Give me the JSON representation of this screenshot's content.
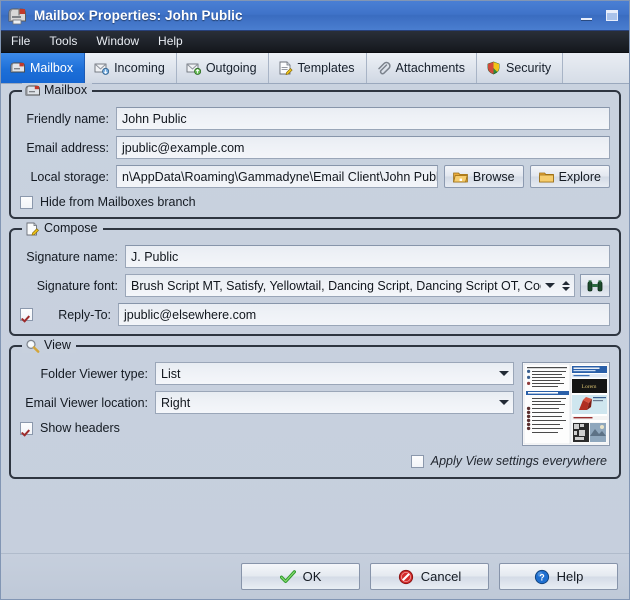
{
  "window": {
    "title": "Mailbox Properties: John Public",
    "app_icon": "mailbox-icon",
    "minimize_label": "Minimize",
    "maximize_label": "Maximize"
  },
  "menubar": {
    "items": [
      {
        "label": "File"
      },
      {
        "label": "Tools"
      },
      {
        "label": "Window"
      },
      {
        "label": "Help"
      }
    ]
  },
  "tabs": [
    {
      "label": "Mailbox",
      "icon": "mailbox-icon",
      "active": true
    },
    {
      "label": "Incoming",
      "icon": "inbox-icon",
      "active": false
    },
    {
      "label": "Outgoing",
      "icon": "outbox-icon",
      "active": false
    },
    {
      "label": "Templates",
      "icon": "template-icon",
      "active": false
    },
    {
      "label": "Attachments",
      "icon": "paperclip-icon",
      "active": false
    },
    {
      "label": "Security",
      "icon": "shield-icon",
      "active": false
    }
  ],
  "mailbox_group": {
    "title": "Mailbox",
    "icon": "mailbox-icon",
    "friendly_name_label": "Friendly name:",
    "friendly_name_value": "John Public",
    "email_address_label": "Email address:",
    "email_address_value": "jpublic@example.com",
    "local_storage_label": "Local storage:",
    "local_storage_value": "n\\AppData\\Roaming\\Gammadyne\\Email Client\\John Public",
    "browse_label": "Browse",
    "explore_label": "Explore",
    "hide_checkbox_label": "Hide from Mailboxes branch",
    "hide_checkbox_checked": false
  },
  "compose_group": {
    "title": "Compose",
    "icon": "compose-icon",
    "signature_name_label": "Signature name:",
    "signature_name_value": "J. Public",
    "signature_font_label": "Signature font:",
    "signature_font_value": "Brush Script MT, Satisfy, Yellowtail, Dancing Script, Dancing Script OT, Coc",
    "font_find_icon": "binoculars-icon",
    "reply_to_label": "Reply-To:",
    "reply_to_value": "jpublic@elsewhere.com",
    "reply_to_checked": true
  },
  "view_group": {
    "title": "View",
    "icon": "magnifier-icon",
    "folder_viewer_label": "Folder Viewer type:",
    "folder_viewer_value": "List",
    "email_viewer_label": "Email Viewer location:",
    "email_viewer_value": "Right",
    "show_headers_label": "Show headers",
    "show_headers_checked": true,
    "apply_everywhere_label": "Apply View settings everywhere",
    "apply_everywhere_checked": false,
    "preview_alt": "layout-preview-thumbnail"
  },
  "footer": {
    "ok_label": "OK",
    "cancel_label": "Cancel",
    "help_label": "Help"
  },
  "colors": {
    "titlebar_blue": "#3f73c9",
    "active_tab_blue": "#1d6fd8",
    "window_bg": "#c8d1de",
    "menubar_dark": "#1d2128",
    "check_red": "#9d2b2b",
    "ok_green": "#2f9b2f",
    "cancel_red": "#cf2020",
    "help_blue": "#1f6fd0"
  }
}
